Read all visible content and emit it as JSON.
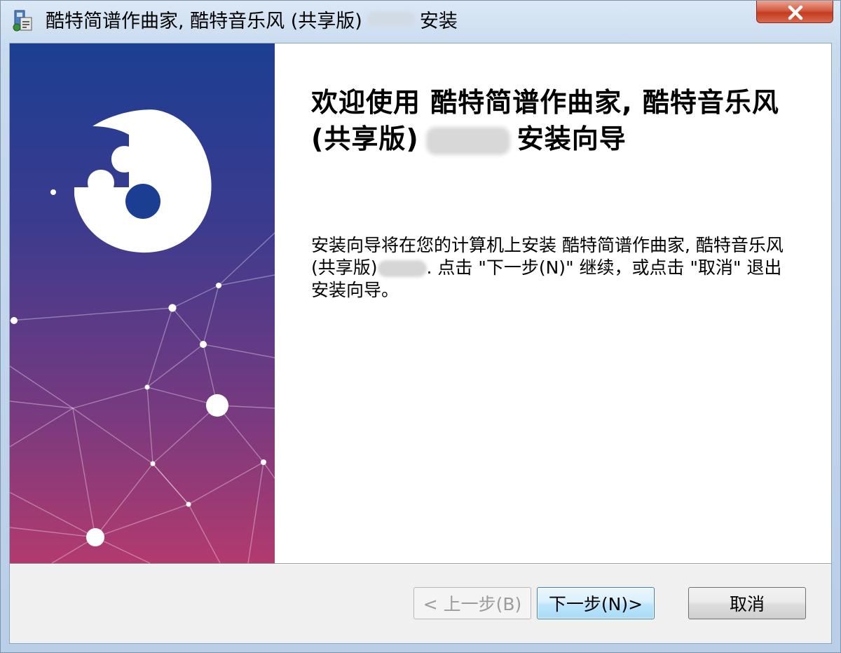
{
  "window": {
    "title_prefix": "酷特简谱作曲家, 酷特音乐风 (共享版)",
    "title_suffix": "安装"
  },
  "welcome": {
    "title_part1": "欢迎使用 酷特简谱作曲家, 酷特音乐风 (共享版)",
    "title_part2": "安装向导",
    "desc_part1": "安装向导将在您的计算机上安装 酷特简谱作曲家, 酷特音乐风 (共享版)",
    "desc_part2": ". 点击 \"下一步(N)\" 继续，或点击 \"取消\" 退出安装向导。"
  },
  "buttons": {
    "back": "< 上一步(B)",
    "next": "下一步(N)>",
    "cancel": "取消"
  },
  "colors": {
    "banner_top": "#1c3e92",
    "banner_bottom": "#b23a6e",
    "close_button": "#c7462b"
  },
  "icons": [
    "installer-icon",
    "close-icon",
    "puzzle-logo-icon"
  ]
}
